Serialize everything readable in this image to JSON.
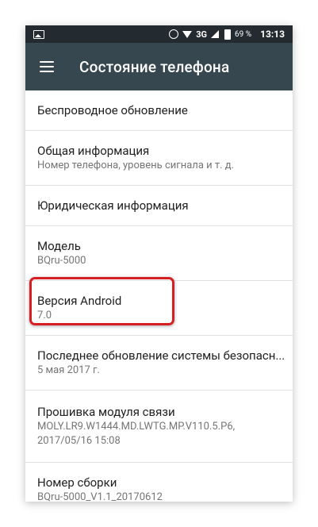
{
  "status_bar": {
    "network": "3G",
    "battery_percent": "69 %",
    "time": "13:13",
    "icons": [
      "image-icon",
      "alarm-icon",
      "wifi-icon",
      "signal-icon",
      "battery-icon"
    ]
  },
  "toolbar": {
    "title": "Состояние телефона",
    "menu_icon": "hamburger-menu-icon"
  },
  "items": [
    {
      "title": "Беспроводное обновление"
    },
    {
      "title": "Общая информация",
      "subtitle": "Номер телефона, уровень сигнала и т. д."
    },
    {
      "title": "Юридическая информация"
    },
    {
      "title": "Модель",
      "subtitle": "BQru-5000"
    },
    {
      "title": "Версия Android",
      "subtitle": "7.0"
    },
    {
      "title": "Последнее обновление системы безопасн...",
      "subtitle": "5 мая 2017 г."
    },
    {
      "title": "Прошивка модуля связи",
      "subtitle": "MOLY.LR9.W1444.MD.LWTG.MP.V110.5.P6,",
      "subtitle2": "2017/05/16 15:08"
    },
    {
      "title": "Номер сборки",
      "subtitle": "BQru-5000_V1.1_20170612"
    }
  ],
  "colors": {
    "status_bar": "#232b30",
    "toolbar": "#37474f",
    "highlight": "#d51f23"
  }
}
